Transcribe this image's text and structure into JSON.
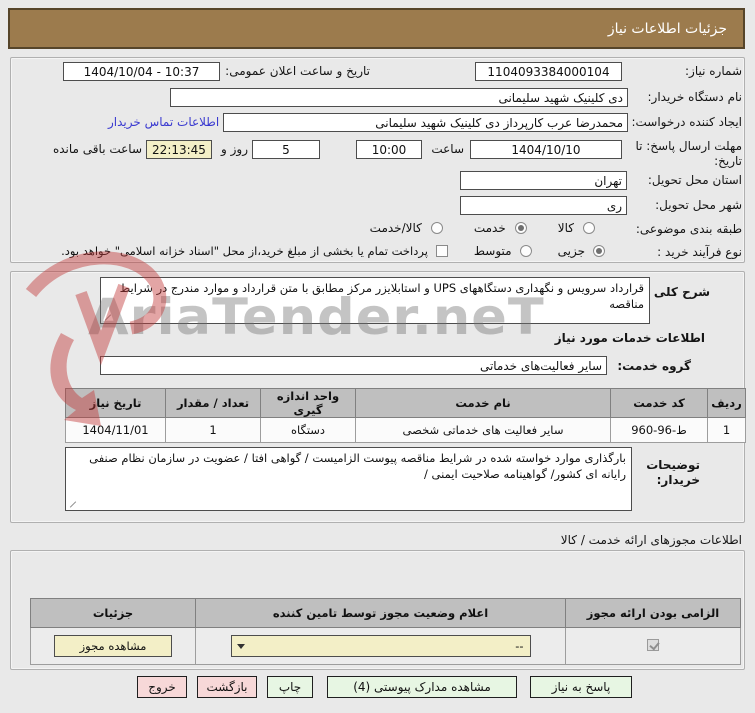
{
  "title": "جزئیات اطلاعات نیاز",
  "watermark": {
    "text": "AriaTender.neT"
  },
  "section1": {
    "need_number_label": "شماره نیاز:",
    "need_number_value": "1104093384000104",
    "announce_label": "تاریخ و ساعت اعلان عمومی:",
    "announce_value": "1404/10/04 - 10:37",
    "buyer_org_label": "نام دستگاه خریدار:",
    "buyer_org_value": "دی کلینیک شهید سلیمانی",
    "creator_label": "ایجاد کننده درخواست:",
    "creator_value": "محمدرضا عرب کارپرداز دی کلینیک شهید سلیمانی",
    "contact_link": "اطلاعات تماس خریدار",
    "deadline_label": "مهلت ارسال پاسخ: تا تاریخ:",
    "deadline_date": "1404/10/10",
    "hour_label": "ساعت",
    "deadline_time": "10:00",
    "days_value": "5",
    "days_label": "روز و",
    "remaining_time": "22:13:45",
    "remaining_label": "ساعت باقی مانده",
    "province_label": "استان محل تحویل:",
    "province_value": "تهران",
    "city_label": "شهر محل تحویل:",
    "city_value": "ری",
    "classification_label": "طبقه بندی موضوعی:",
    "class_option_goods": "کالا",
    "class_option_service": "خدمت",
    "class_option_both": "کالا/خدمت",
    "class_selected": "خدمت",
    "process_label": "نوع فرآیند خرید :",
    "process_option_partial": "جزیی",
    "process_option_medium": "متوسط",
    "process_selected": "جزیی",
    "treasury_checkbox_label": "پرداخت تمام یا بخشی از مبلغ خرید،از محل \"اسناد خزانه اسلامی\" خواهد بود."
  },
  "section2": {
    "desc_label": "شرح کلی نیاز:",
    "desc_value": "قرارداد سرویس و نگهداری دستگاههای UPS و استابلایزر مرکز مطابق با متن قرارداد و موارد مندرج در شرایط مناقصه",
    "services_header": "اطلاعات خدمات مورد نیاز",
    "group_label": "گروه خدمت:",
    "group_value": "سایر فعالیت‌های خدماتی",
    "table": {
      "headers": [
        "ردیف",
        "کد خدمت",
        "نام خدمت",
        "واحد اندازه گیری",
        "تعداد / مقدار",
        "تاریخ نیاز"
      ],
      "rows": [
        [
          "1",
          "ط-96-960",
          "سایر فعالیت های خدماتی شخصی",
          "دستگاه",
          "1",
          "1404/11/01"
        ]
      ]
    },
    "buyer_notes_label": "توضیحات خریدار:",
    "buyer_notes_value": "بارگذاری موارد خواسته شده در شرایط مناقصه پیوست الزامیست / گواهی افتا / عضویت در سازمان نظام صنفی رایانه ای کشور/ گواهینامه صلاحیت ایمنی /"
  },
  "section3": {
    "header": "اطلاعات مجوزهای ارائه خدمت / کالا",
    "col_mandatory": "الزامی بودن ارائه مجوز",
    "col_status": "اعلام وضعیت مجوز توسط تامین کننده",
    "col_details": "جزئیات",
    "mandatory_checked": true,
    "dropdown_value": "--",
    "view_license_button": "مشاهده مجوز"
  },
  "footer": {
    "respond_button": "پاسخ به نیاز",
    "attachments_button": "مشاهده مدارک پیوستی (4)",
    "print_button": "چاپ",
    "back_button": "بازگشت",
    "exit_button": "خروج"
  },
  "colors": {
    "titlebar": "#9c7b4d",
    "beige": "#f3efc7",
    "green_button": "#e7f6e3",
    "pink_button": "#f7d8d8",
    "table_header": "#bfbfbf",
    "link": "#3a3ad0"
  }
}
